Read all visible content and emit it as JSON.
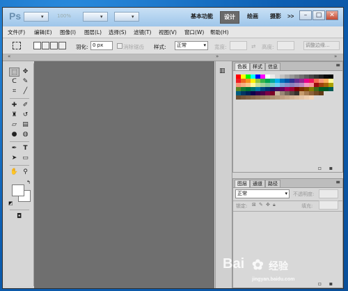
{
  "app": {
    "logo": "Ps",
    "zoom": "100%"
  },
  "workspaces": [
    {
      "label": "基本功能",
      "active": false
    },
    {
      "label": "设计",
      "active": true
    },
    {
      "label": "绘画",
      "active": false
    },
    {
      "label": "摄影",
      "active": false
    },
    {
      "label": ">>",
      "active": false
    }
  ],
  "window_controls": {
    "minimize": "–",
    "restore": "□",
    "close": "✕"
  },
  "menu": [
    "文件(F)",
    "编辑(E)",
    "图像(I)",
    "图层(L)",
    "选择(S)",
    "滤镜(T)",
    "视图(V)",
    "窗口(W)",
    "帮助(H)"
  ],
  "options": {
    "feather_label": "羽化:",
    "feather_value": "0 px",
    "antialias_label": "消除锯齿",
    "style_label": "样式:",
    "style_value": "正常",
    "width_label": "宽度:",
    "height_label": "高度:",
    "refine_edge": "调整边缘..."
  },
  "swatches_panel": {
    "tabs": [
      "色板",
      "样式",
      "信息"
    ]
  },
  "layers_panel": {
    "tabs": [
      "图层",
      "通道",
      "路径"
    ],
    "blend_mode": "正常",
    "opacity_label": "不透明度:",
    "lock_label": "锁定:",
    "fill_label": "填充:"
  },
  "watermark": {
    "brand": "Bai",
    "brand2": "经验",
    "url": "jingyan.baidu.com"
  },
  "colors": {
    "canvas": "#6f6f6f",
    "accent": "#0f73c9"
  }
}
